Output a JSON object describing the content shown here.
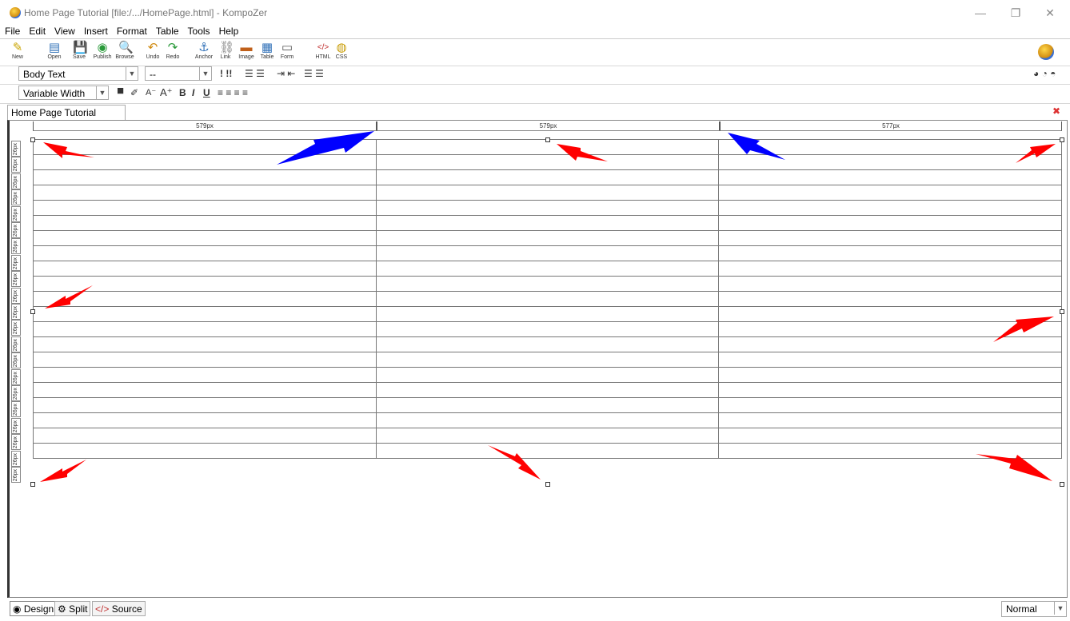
{
  "window": {
    "title": "Home Page Tutorial [file:/.../HomePage.html] - KompoZer",
    "minimize": "—",
    "restore": "❐",
    "close": "✕"
  },
  "menu": [
    "File",
    "Edit",
    "View",
    "Insert",
    "Format",
    "Table",
    "Tools",
    "Help"
  ],
  "toolbar": [
    {
      "label": "New",
      "icon": "✎",
      "color": "#c9a400"
    },
    {
      "label": "Open",
      "icon": "▤",
      "color": "#2e6fb7"
    },
    {
      "label": "Save",
      "icon": "💾",
      "color": "#666"
    },
    {
      "label": "Publish",
      "icon": "◉",
      "color": "#2a9a3a"
    },
    {
      "label": "Browse",
      "icon": "🔍",
      "color": "#888"
    },
    {
      "label": "Undo",
      "icon": "↶",
      "color": "#d08a10"
    },
    {
      "label": "Redo",
      "icon": "↷",
      "color": "#2a9a3a"
    },
    {
      "label": "Anchor",
      "icon": "⚓",
      "color": "#2e6fb7"
    },
    {
      "label": "Link",
      "icon": "⛓",
      "color": "#777"
    },
    {
      "label": "Image",
      "icon": "▬",
      "color": "#c0601a"
    },
    {
      "label": "Table",
      "icon": "▦",
      "color": "#2e6fb7"
    },
    {
      "label": "Form",
      "icon": "▭",
      "color": "#555"
    },
    {
      "label": "HTML",
      "icon": "</>",
      "color": "#c03030"
    },
    {
      "label": "CSS",
      "icon": "◍",
      "color": "#c79a00"
    }
  ],
  "format1": {
    "paragraph_format": "Body Text",
    "font_face": "--"
  },
  "format2": {
    "width_mode": "Variable Width"
  },
  "document_tab": "Home Page Tutorial",
  "ruler": {
    "columns": [
      "579px",
      "579px",
      "577px"
    ],
    "row_label": "26px"
  },
  "table": {
    "rows": 21,
    "cols": 3
  },
  "annotations": {
    "red_color": "#ff0000",
    "blue_color": "#0000ff"
  },
  "bottom_tabs": [
    {
      "label": "Design",
      "icon": "◉",
      "active": true
    },
    {
      "label": "Split",
      "icon": "⚙",
      "active": false
    },
    {
      "label": "Source",
      "icon": "</>",
      "active": false
    }
  ],
  "view_mode": "Normal"
}
